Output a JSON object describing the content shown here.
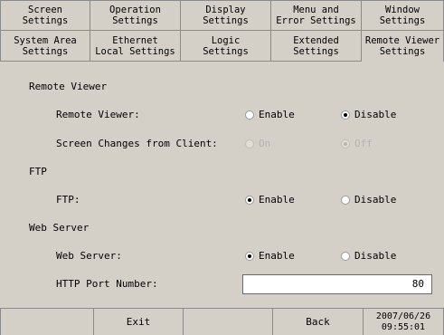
{
  "tabs_row1": [
    {
      "line1": "Screen",
      "line2": "Settings"
    },
    {
      "line1": "Operation",
      "line2": "Settings"
    },
    {
      "line1": "Display",
      "line2": "Settings"
    },
    {
      "line1": "Menu and",
      "line2": "Error Settings"
    },
    {
      "line1": "Window",
      "line2": "Settings"
    }
  ],
  "tabs_row2": [
    {
      "line1": "System Area",
      "line2": "Settings"
    },
    {
      "line1": "Ethernet",
      "line2": "Local Settings"
    },
    {
      "line1": "Logic",
      "line2": "Settings"
    },
    {
      "line1": "Extended",
      "line2": "Settings"
    },
    {
      "line1": "Remote Viewer",
      "line2": "Settings",
      "active": true
    }
  ],
  "sections": {
    "remote_viewer": {
      "heading": "Remote Viewer",
      "remote_viewer_label": "Remote Viewer:",
      "enable": "Enable",
      "disable": "Disable",
      "selected": "Disable",
      "screen_changes_label": "Screen Changes from Client:",
      "on": "On",
      "off": "Off",
      "screen_changes_selected": "Off"
    },
    "ftp": {
      "heading": "FTP",
      "label": "FTP:",
      "enable": "Enable",
      "disable": "Disable",
      "selected": "Enable"
    },
    "web_server": {
      "heading": "Web Server",
      "label": "Web Server:",
      "enable": "Enable",
      "disable": "Disable",
      "selected": "Enable",
      "port_label": "HTTP Port Number:",
      "port_value": "80"
    }
  },
  "bottom_bar": {
    "exit": "Exit",
    "back": "Back",
    "date": "2007/06/26",
    "time": "09:55:01"
  }
}
